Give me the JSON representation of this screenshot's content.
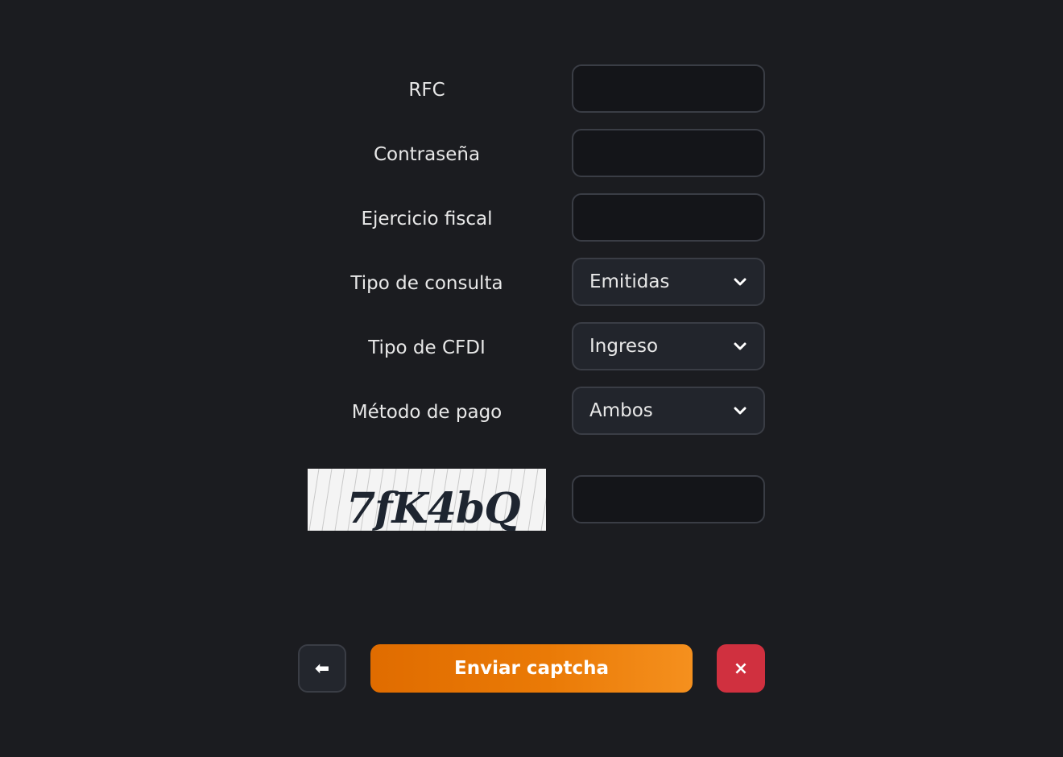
{
  "form": {
    "rfc": {
      "label": "RFC",
      "value": ""
    },
    "password": {
      "label": "Contraseña",
      "value": ""
    },
    "fiscal_year": {
      "label": "Ejercicio fiscal",
      "value": ""
    },
    "query_type": {
      "label": "Tipo de consulta",
      "selected": "Emitidas"
    },
    "cfdi_type": {
      "label": "Tipo de CFDI",
      "selected": "Ingreso"
    },
    "payment_method": {
      "label": "Método de pago",
      "selected": "Ambos"
    },
    "captcha": {
      "image_text": "7fK4bQ",
      "value": ""
    }
  },
  "actions": {
    "back_icon": "arrow-left-icon",
    "back_glyph": "⬅",
    "submit_label": "Enviar captcha",
    "close_icon": "close-icon",
    "close_glyph": "×"
  },
  "colors": {
    "background": "#1b1c20",
    "accent": "#ea7a06",
    "danger": "#d0303f"
  }
}
